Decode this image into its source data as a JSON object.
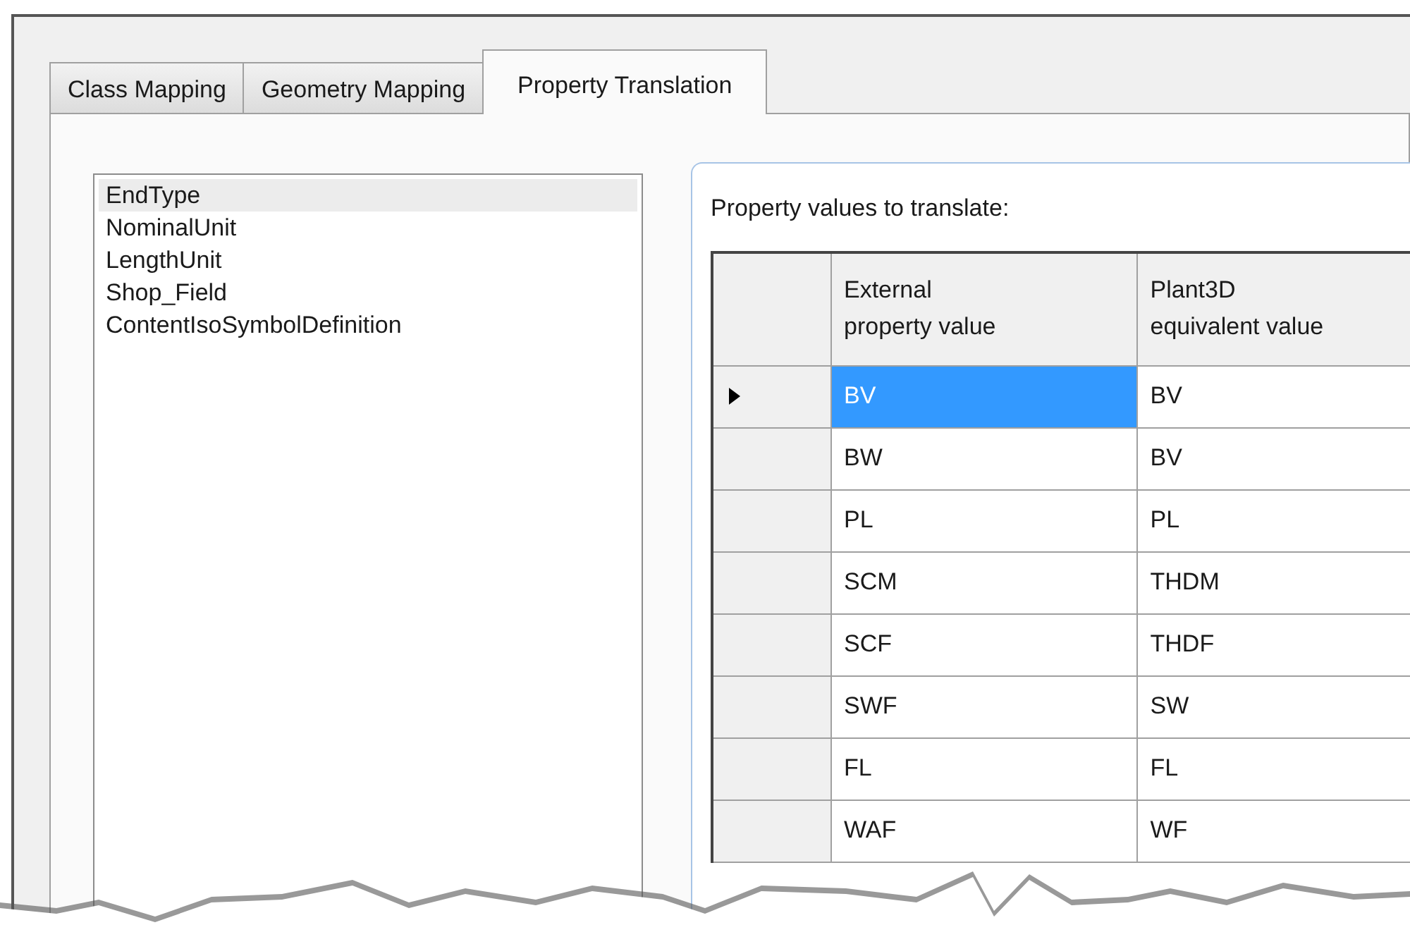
{
  "tabs": [
    {
      "label": "Class Mapping",
      "selected": false
    },
    {
      "label": "Geometry Mapping",
      "selected": false
    },
    {
      "label": "Property Translation",
      "selected": true
    }
  ],
  "properties": [
    {
      "label": "EndType",
      "selected": true
    },
    {
      "label": "NominalUnit",
      "selected": false
    },
    {
      "label": "LengthUnit",
      "selected": false
    },
    {
      "label": "Shop_Field",
      "selected": false
    },
    {
      "label": "ContentIsoSymbolDefinition",
      "selected": false
    }
  ],
  "grid": {
    "label": "Property values to translate:",
    "columns": [
      "External\nproperty value",
      "Plant3D\nequivalent value"
    ],
    "rows": [
      {
        "current": true,
        "cells": [
          "BV",
          "BV"
        ],
        "selected": true
      },
      {
        "current": false,
        "cells": [
          "BW",
          "BV"
        ],
        "selected": false
      },
      {
        "current": false,
        "cells": [
          "PL",
          "PL"
        ],
        "selected": false
      },
      {
        "current": false,
        "cells": [
          "SCM",
          "THDM"
        ],
        "selected": false
      },
      {
        "current": false,
        "cells": [
          "SCF",
          "THDF"
        ],
        "selected": false
      },
      {
        "current": false,
        "cells": [
          "SWF",
          "SW"
        ],
        "selected": false
      },
      {
        "current": false,
        "cells": [
          "FL",
          "FL"
        ],
        "selected": false
      },
      {
        "current": false,
        "cells": [
          "WAF",
          "WF"
        ],
        "selected": false
      }
    ]
  }
}
